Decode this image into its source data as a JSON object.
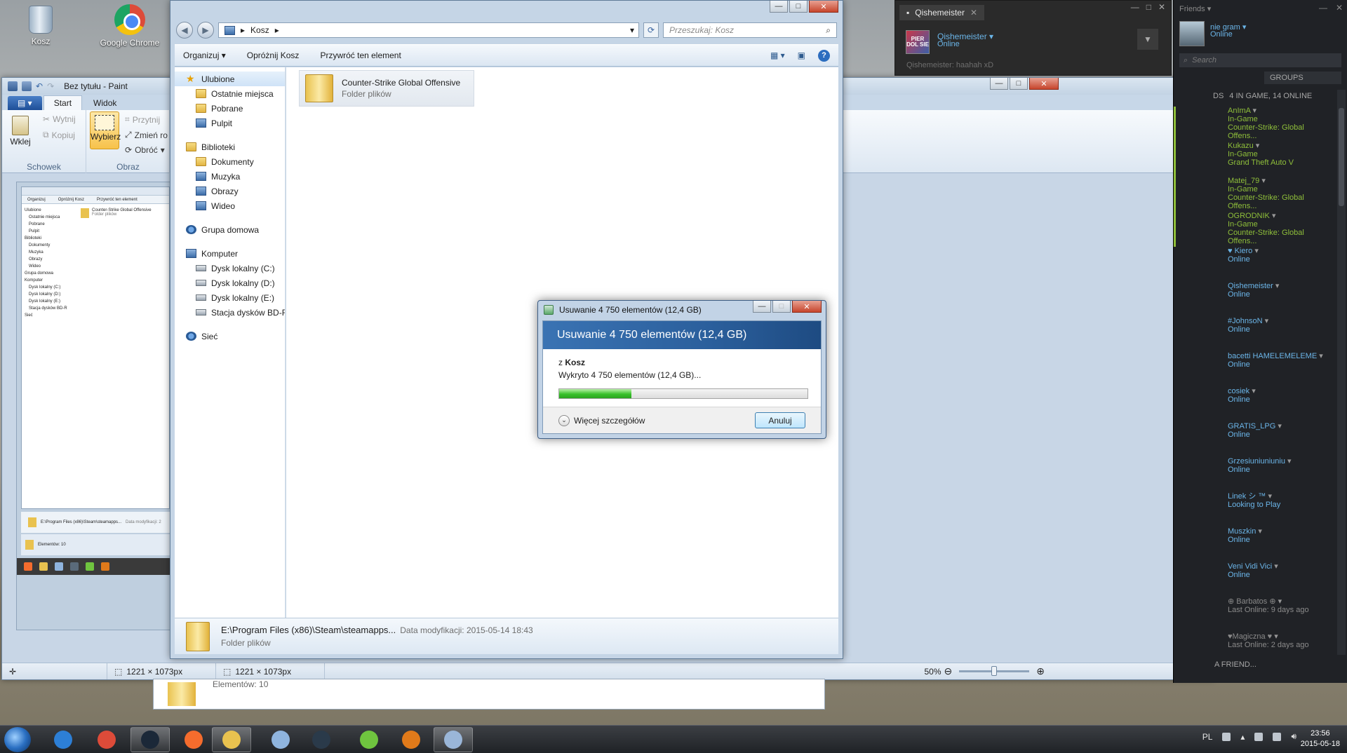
{
  "desktop": {
    "icons": [
      {
        "label": "Kosz"
      },
      {
        "label": "Google Chrome"
      }
    ]
  },
  "paint": {
    "title": "Bez tytułu - Paint",
    "tabs": [
      "Start",
      "Widok"
    ],
    "ribbon": {
      "paste": "Wklej",
      "cut": "Wytnij",
      "copy": "Kopiuj",
      "clipboard_group": "Schowek",
      "select": "Wybierz",
      "crop": "Przytnij",
      "resize": "Zmień ro",
      "rotate": "Obróć",
      "image_group": "Obraz"
    },
    "status": {
      "selection_size": "1221 × 1073px",
      "image_size": "1221 × 1073px",
      "zoom": "50%",
      "zoom_fraction": 0.5
    },
    "mini": {
      "toolbar": [
        "Organizuj",
        "Opróżnij Kosz",
        "Przywróć ten element"
      ],
      "file": "Counter-Strike Global Offensive",
      "file_sub": "Folder plików",
      "nav": [
        "Ulubione",
        "Ostatnie miejsca",
        "Pobrane",
        "Pulpit",
        "Biblioteki",
        "Dokumenty",
        "Muzyka",
        "Obrazy",
        "Wideo",
        "Grupa domowa",
        "Komputer",
        "Dysk lokalny (C:)",
        "Dysk lokalny (D:)",
        "Dysk lokalny (E:)",
        "Stacja dysków BD-R",
        "Sieć"
      ],
      "detail": "E:\\Program Files (x86)\\Steam\\steamapps...",
      "detail_mod": "Data modyfikacji: 2",
      "items": "Elementów: 10"
    }
  },
  "explorer": {
    "breadcrumb": "Kosz",
    "search_placeholder": "Przeszukaj: Kosz",
    "toolbar": {
      "organize": "Organizuj",
      "empty": "Opróżnij Kosz",
      "restore": "Przywróć ten element"
    },
    "nav": [
      {
        "label": "Ulubione",
        "level": 0,
        "icon": "star"
      },
      {
        "label": "Ostatnie miejsca",
        "level": 1,
        "icon": "folder"
      },
      {
        "label": "Pobrane",
        "level": 1,
        "icon": "folder"
      },
      {
        "label": "Pulpit",
        "level": 1,
        "icon": "blue"
      },
      {
        "label": "",
        "level": -1
      },
      {
        "label": "Biblioteki",
        "level": 0,
        "icon": "folder"
      },
      {
        "label": "Dokumenty",
        "level": 1,
        "icon": "folder"
      },
      {
        "label": "Muzyka",
        "level": 1,
        "icon": "blue"
      },
      {
        "label": "Obrazy",
        "level": 1,
        "icon": "blue"
      },
      {
        "label": "Wideo",
        "level": 1,
        "icon": "blue"
      },
      {
        "label": "",
        "level": -1
      },
      {
        "label": "Grupa domowa",
        "level": 0,
        "icon": "net"
      },
      {
        "label": "",
        "level": -1
      },
      {
        "label": "Komputer",
        "level": 0,
        "icon": "blue"
      },
      {
        "label": "Dysk lokalny (C:)",
        "level": 1,
        "icon": "drive"
      },
      {
        "label": "Dysk lokalny (D:)",
        "level": 1,
        "icon": "drive"
      },
      {
        "label": "Dysk lokalny (E:)",
        "level": 1,
        "icon": "drive"
      },
      {
        "label": "Stacja dysków BD-R",
        "level": 1,
        "icon": "drive"
      },
      {
        "label": "",
        "level": -1
      },
      {
        "label": "Sieć",
        "level": 0,
        "icon": "net"
      }
    ],
    "file": {
      "name": "Counter-Strike Global Offensive",
      "type": "Folder plików"
    },
    "details": {
      "path": "E:\\Program Files (x86)\\Steam\\steamapps...",
      "modified": "Data modyfikacji: 2015-05-14 18:43",
      "type": "Folder plików"
    },
    "behind_items": "Elementów: 10"
  },
  "dialog": {
    "title": "Usuwanie 4 750 elementów (12,4 GB)",
    "heading": "Usuwanie 4 750 elementów (12,4 GB)",
    "from_prefix": "z",
    "from_location": "Kosz",
    "found": "Wykryto 4 750 elementów (12,4 GB)...",
    "progress": 0.29,
    "more_details": "Więcej szczegółów",
    "cancel": "Anuluj"
  },
  "steam_chat": {
    "tab": "Qishemeister",
    "avatar_text": "PIER DOL SIE",
    "name": "Qishemeister",
    "status": "Online",
    "last_message": "Qishemeister: haahah xD"
  },
  "steam_friends": {
    "title": "Friends",
    "me_name": "nie gram",
    "me_status": "Online",
    "search_placeholder": "Search",
    "groups": "GROUPS",
    "count_prefix": "DS",
    "count": "4 IN GAME, 14 ONLINE",
    "add_friend": "A FRIEND...",
    "list": [
      {
        "name": "AnImA",
        "status": "In-Game",
        "game": "Counter-Strike: Global Offens...",
        "state": "ingame"
      },
      {
        "name": "Kukazu",
        "status": "In-Game",
        "game": "Grand Theft Auto V",
        "state": "ingame"
      },
      {
        "name": "Matej_79",
        "status": "In-Game",
        "game": "Counter-Strike: Global Offens...",
        "state": "ingame"
      },
      {
        "name": "OGRODNIK",
        "status": "In-Game",
        "game": "Counter-Strike: Global Offens...",
        "state": "ingame"
      },
      {
        "name": "♥ Kiero",
        "status": "Online",
        "game": "",
        "state": "online"
      },
      {
        "name": "Qishemeister",
        "status": "Online",
        "game": "",
        "state": "online"
      },
      {
        "name": "#JohnsoN",
        "status": "Online",
        "game": "",
        "state": "online"
      },
      {
        "name": "bacetti HAMELEMELEME",
        "status": "Online",
        "game": "",
        "state": "online"
      },
      {
        "name": "cosiek",
        "status": "Online",
        "game": "",
        "state": "online"
      },
      {
        "name": "GRATIS_LPG",
        "status": "Online",
        "game": "",
        "state": "online"
      },
      {
        "name": "Grzesiuniuniuniu",
        "status": "Online",
        "game": "",
        "state": "online"
      },
      {
        "name": "Linek シ ™",
        "status": "Looking to Play",
        "game": "",
        "state": "online"
      },
      {
        "name": "Muszkin",
        "status": "Online",
        "game": "",
        "state": "online"
      },
      {
        "name": "Veni Vidi Vici",
        "status": "Online",
        "game": "",
        "state": "online"
      },
      {
        "name": "⊕ Barbatos ⊕",
        "status": "Last Online: 9 days ago",
        "game": "",
        "state": "offline"
      },
      {
        "name": "♥Magiczna ♥",
        "status": "Last Online: 2 days ago",
        "game": "",
        "state": "offline"
      }
    ]
  },
  "taskbar": {
    "items": [
      {
        "name": "ie-icon",
        "color": "#2d7fd6"
      },
      {
        "name": "chrome-icon",
        "color": "#dd4b39"
      },
      {
        "name": "steam-icon",
        "color": "#1b2838",
        "active": true
      },
      {
        "name": "origin-icon",
        "color": "#f56c2d"
      },
      {
        "name": "explorer-icon",
        "color": "#e9c24f",
        "active": true
      },
      {
        "name": "calculator-icon",
        "color": "#8fb4de"
      },
      {
        "name": "media-player-icon",
        "color": "#2a3a4a"
      },
      {
        "name": "utorrent-icon",
        "color": "#6fc43f"
      },
      {
        "name": "mh-icon",
        "color": "#e07a1a"
      },
      {
        "name": "paint-icon",
        "color": "#9ab6d8",
        "active": true
      }
    ],
    "language": "PL",
    "time": "23:56",
    "date": "2015-05-18"
  }
}
